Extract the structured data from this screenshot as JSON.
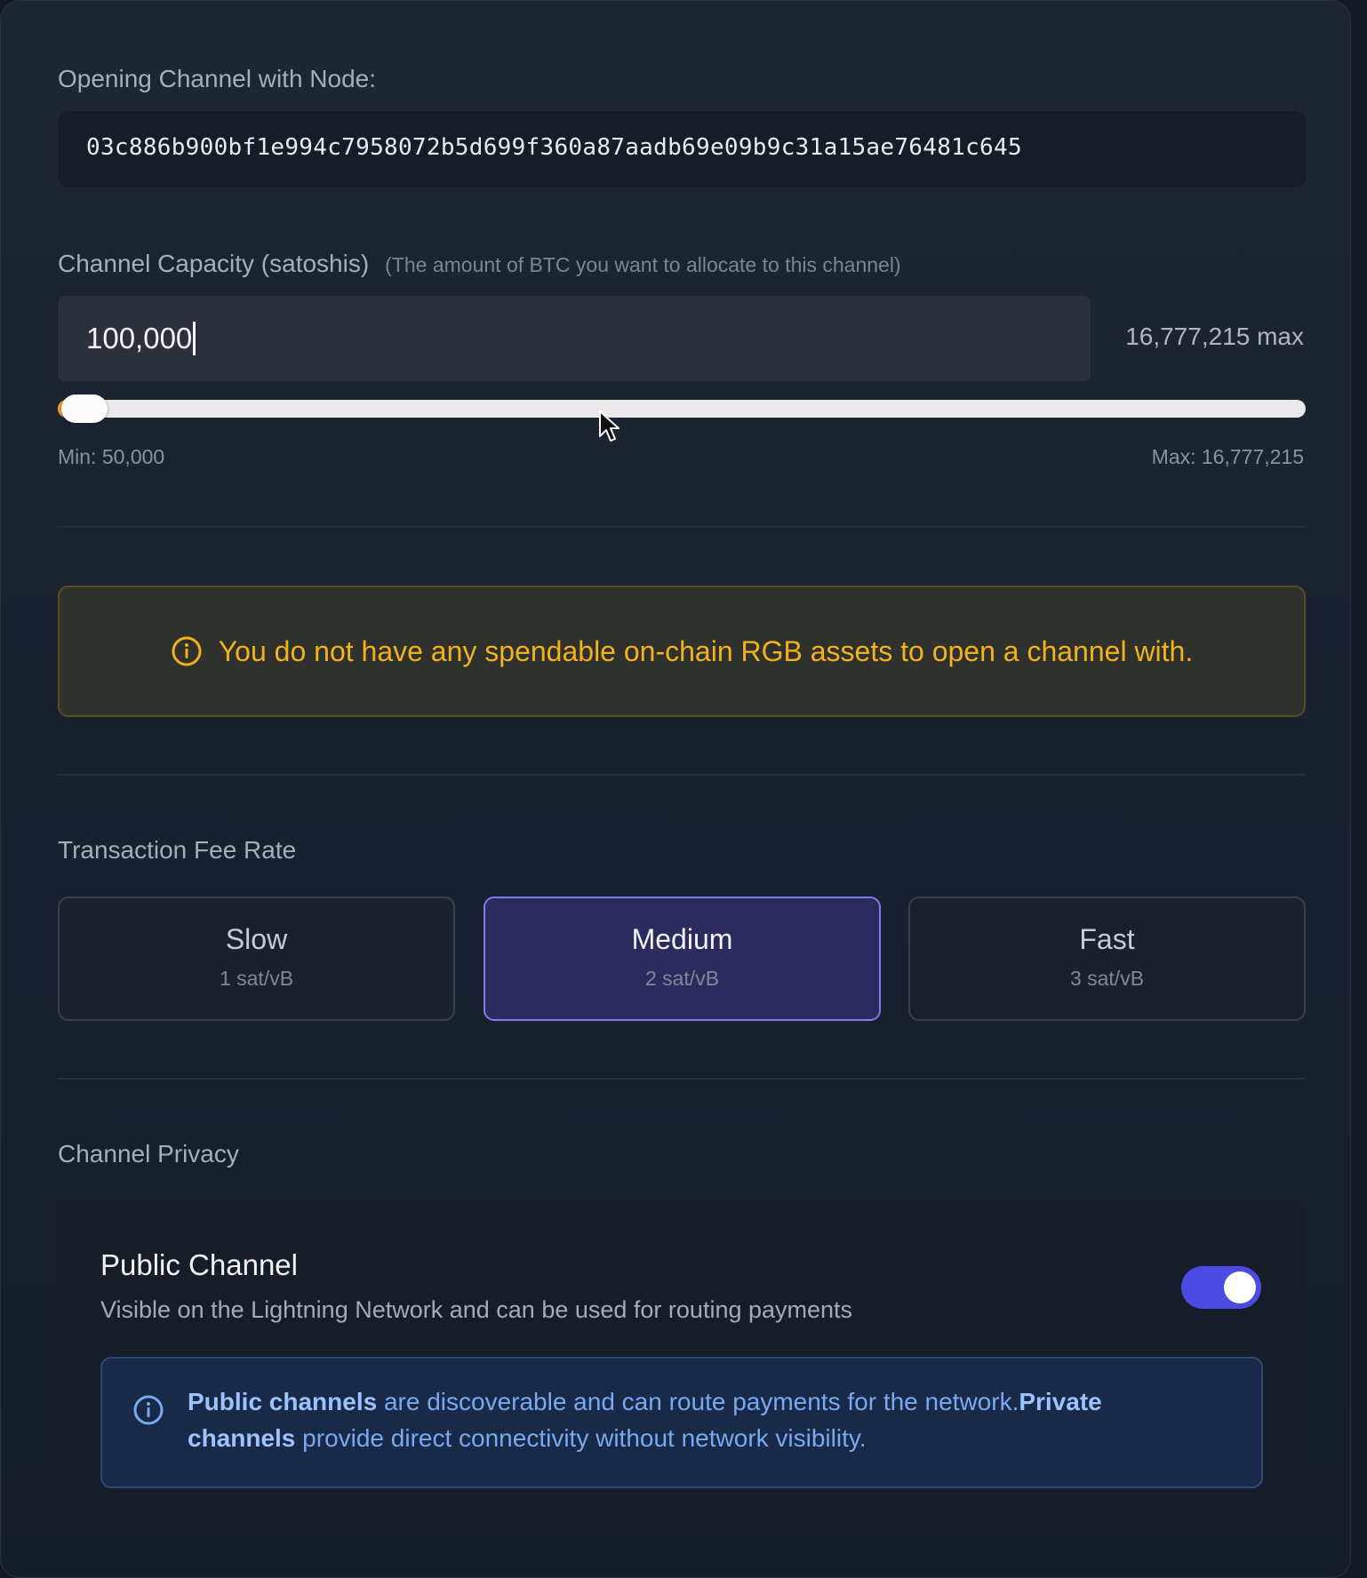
{
  "node": {
    "label": "Opening Channel with Node:",
    "pubkey": "03c886b900bf1e994c7958072b5d699f360a87aadb69e09b9c31a15ae76481c645"
  },
  "capacity": {
    "label": "Channel Capacity (satoshis)",
    "hint": "(The amount of BTC you want to allocate to this channel)",
    "value": "100,000",
    "max_label": "16,777,215 max",
    "min_text": "Min: 50,000",
    "max_text": "Max: 16,777,215",
    "slider_fraction": 0.003
  },
  "warning": {
    "text": "You do not have any spendable on-chain RGB assets to open a channel with.",
    "color": "#f3b21a"
  },
  "fee": {
    "label": "Transaction Fee Rate",
    "options": [
      {
        "name": "Slow",
        "rate": "1 sat/vB"
      },
      {
        "name": "Medium",
        "rate": "2 sat/vB"
      },
      {
        "name": "Fast",
        "rate": "3 sat/vB"
      }
    ],
    "selected": "Medium"
  },
  "privacy": {
    "label": "Channel Privacy",
    "title": "Public Channel",
    "description": "Visible on the Lightning Network and can be used for routing payments",
    "toggle_on": true,
    "info_bold_1": "Public channels",
    "info_text_1": " are discoverable and can route payments for the network.",
    "info_bold_2": "Private channels",
    "info_text_2": " provide direct connectivity without network visibility."
  },
  "colors": {
    "accent": "#4b4be3",
    "selected_border": "#7c7bf0",
    "slider_fill": "#f29b24",
    "info_text": "#79a9f1"
  }
}
